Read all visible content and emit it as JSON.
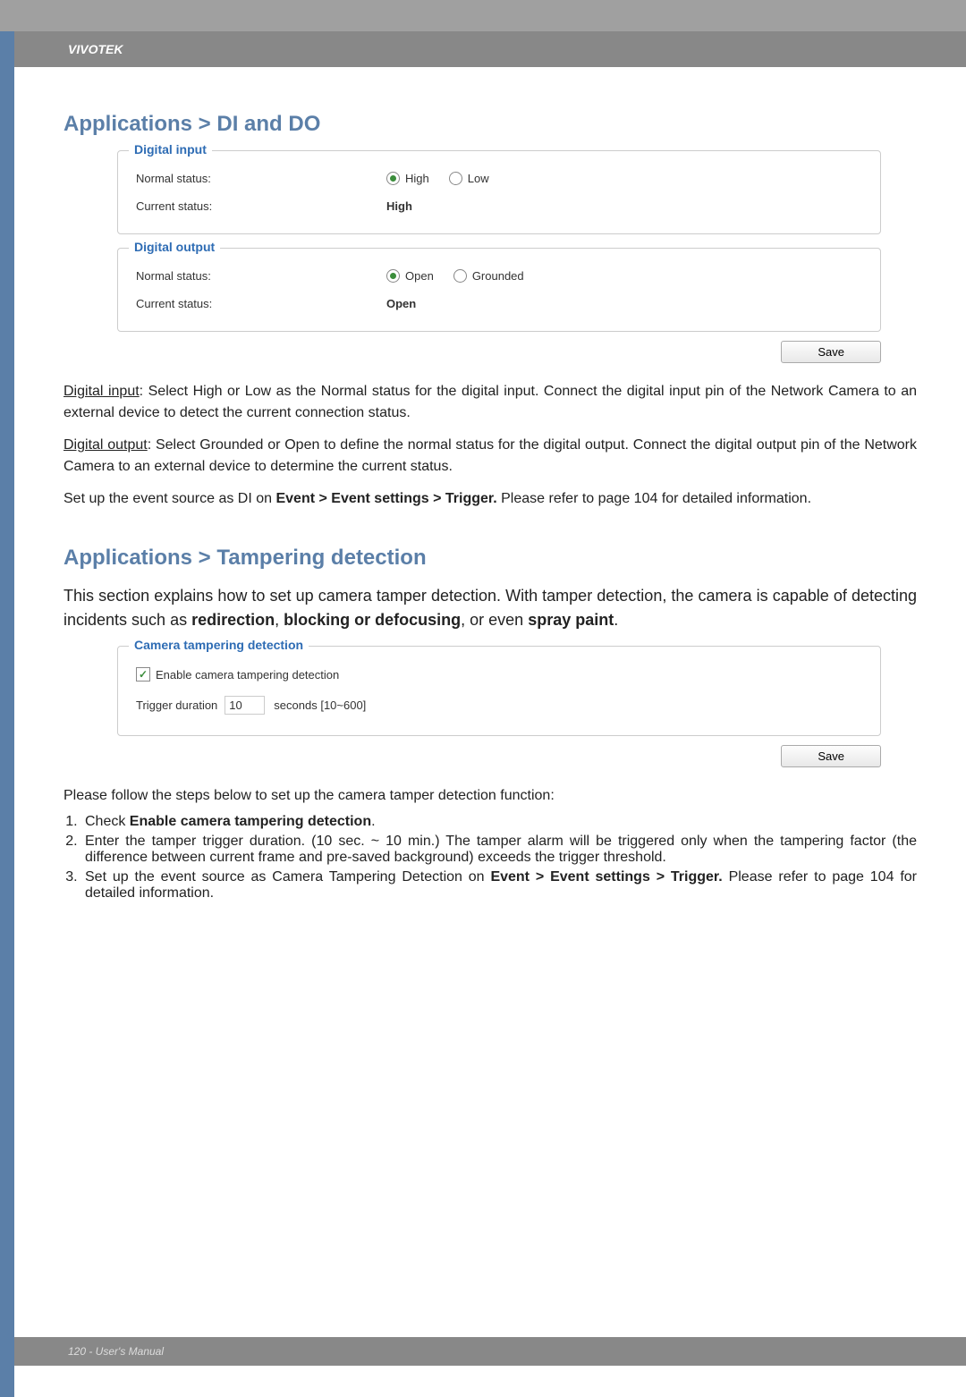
{
  "header": {
    "brand": "VIVOTEK"
  },
  "section1": {
    "title": "Applications > DI and DO",
    "digital_input": {
      "legend": "Digital input",
      "normal_label": "Normal status:",
      "opt_high": "High",
      "opt_low": "Low",
      "current_label": "Current status:",
      "current_value": "High"
    },
    "digital_output": {
      "legend": "Digital output",
      "normal_label": "Normal status:",
      "opt_open": "Open",
      "opt_grounded": "Grounded",
      "current_label": "Current status:",
      "current_value": "Open"
    },
    "save_label": "Save",
    "para_di_prefix": "Digital input",
    "para_di_rest": ": Select High or Low as the Normal status for the digital input. Connect the digital input pin of the Network Camera to an external device to detect the current connection status.",
    "para_do_prefix": "Digital output",
    "para_do_rest": ": Select Grounded or Open to define the normal status for the digital output. Connect the digital output pin of the Network Camera to an external device to determine the current status.",
    "para_event_1": "Set up the event source as DI on ",
    "para_event_bold": "Event > Event settings > Trigger.",
    "para_event_2": " Please refer to page 104 for detailed information."
  },
  "section2": {
    "title": "Applications > Tampering detection",
    "intro_1": "This section explains how to set up camera tamper detection. With tamper detection, the camera is capable of detecting incidents such as ",
    "intro_bold1": "redirection",
    "intro_mid": ", ",
    "intro_bold2": "blocking or defocusing",
    "intro_mid2": ", or even ",
    "intro_bold3": "spray paint",
    "intro_end": ".",
    "tamper_box": {
      "legend": "Camera tampering detection",
      "enable_label": "Enable camera tampering detection",
      "trigger_label": "Trigger duration",
      "trigger_value": "10",
      "trigger_suffix": "seconds [10~600]"
    },
    "save_label": "Save",
    "steps_intro": "Please follow the steps below to set up the camera tamper detection function:",
    "step1_a": "Check ",
    "step1_b": "Enable camera tampering detection",
    "step1_c": ".",
    "step2": "Enter the tamper trigger duration. (10 sec. ~ 10 min.) The tamper alarm will be triggered only when the tampering factor (the difference between current frame and pre-saved background) exceeds the trigger threshold.",
    "step3_a": "Set up the event source as Camera Tampering Detection on ",
    "step3_b": "Event > Event settings > Trigger.",
    "step3_c": " Please refer to page 104 for detailed information."
  },
  "footer": {
    "text": "120 - User's Manual"
  }
}
